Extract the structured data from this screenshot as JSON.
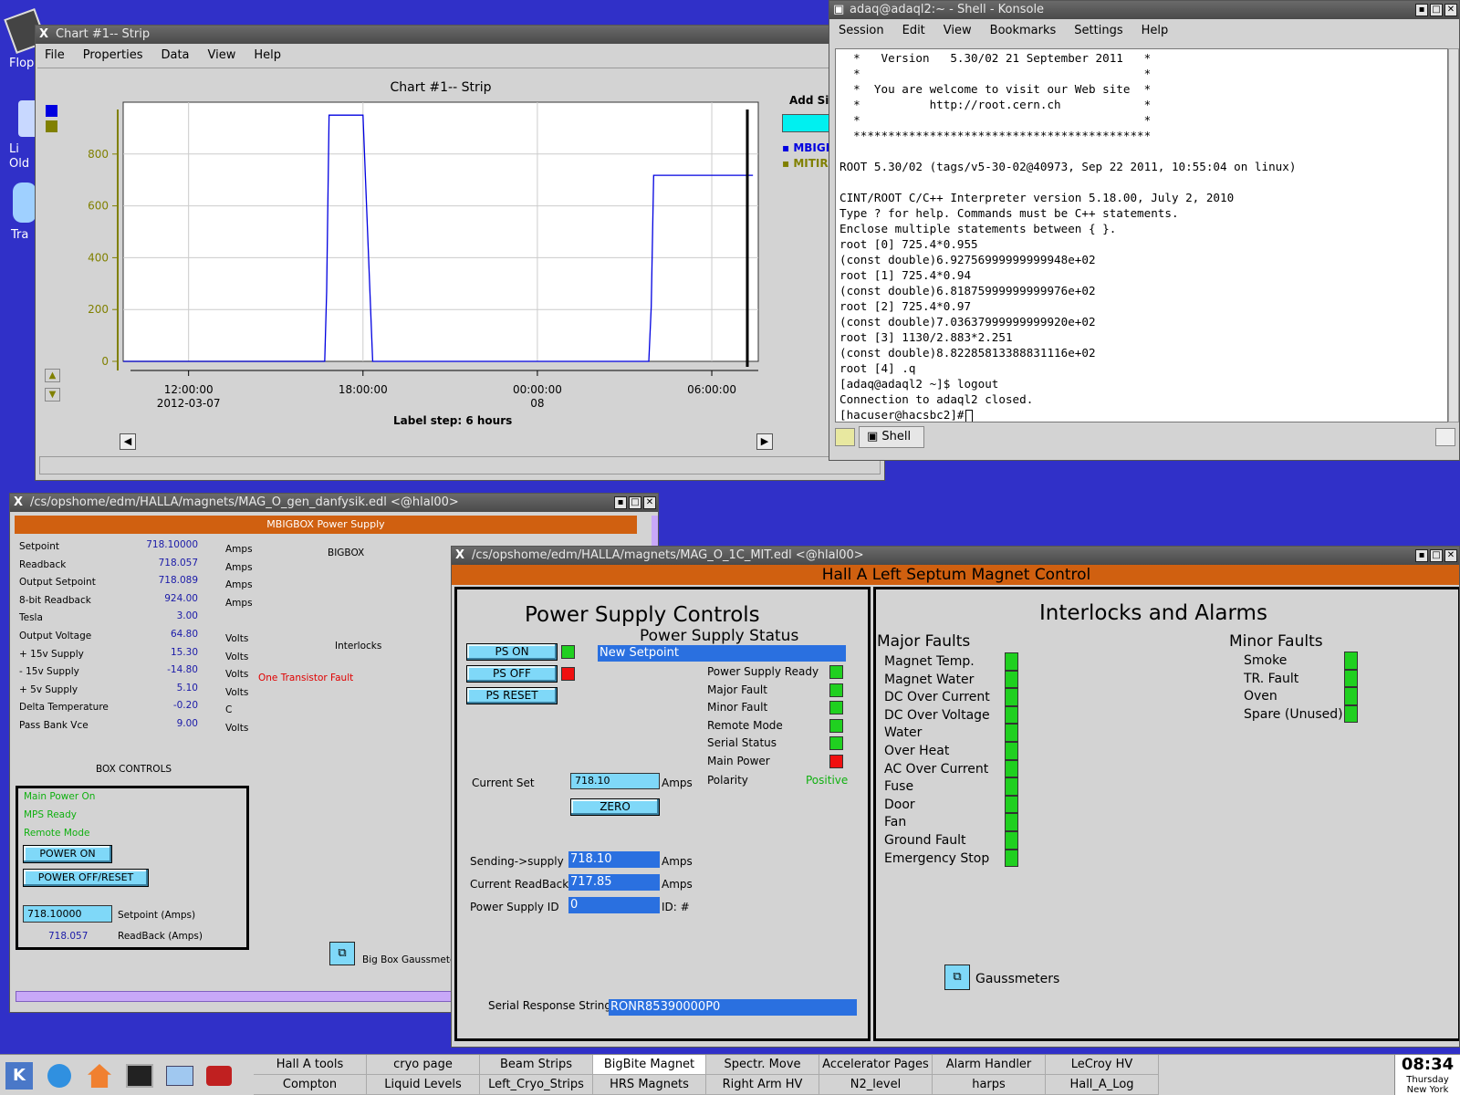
{
  "desktop": {
    "icons": [
      "Flop",
      "Li\nOld",
      "Tra"
    ]
  },
  "chart_window": {
    "title": "Chart #1-- Strip",
    "menu": [
      "File",
      "Properties",
      "Data",
      "View",
      "Help"
    ],
    "add_sig": "Add Sig",
    "legend": [
      "MBIGB",
      "MITIRE"
    ],
    "label_step": "Label step: 6 hours"
  },
  "chart_data": {
    "type": "line",
    "title": "Chart #1-- Strip",
    "xlabel": "",
    "ylabel": "",
    "y_ticks": [
      "0",
      "200",
      "400",
      "600",
      "800"
    ],
    "ylim": [
      0,
      1000
    ],
    "x_ticks": [
      {
        "time": "12:00:00",
        "date": "2012-03-07"
      },
      {
        "time": "18:00:00",
        "date": ""
      },
      {
        "time": "00:00:00",
        "date": "08"
      },
      {
        "time": "06:00:00",
        "date": ""
      }
    ],
    "series": [
      {
        "name": "MBIGB",
        "color": "#0000e0",
        "x": [
          "09:45",
          "16:41",
          "16:45",
          "16:50",
          "18:00",
          "18:20",
          "03:50",
          "03:55",
          "04:00",
          "07:25"
        ],
        "values": [
          0,
          0,
          270,
          950,
          950,
          0,
          0,
          210,
          718,
          718
        ]
      },
      {
        "name": "MITIRE",
        "color": "#808000",
        "x": [
          "09:45",
          "16:41"
        ],
        "values": [
          0,
          0
        ]
      }
    ]
  },
  "konsole": {
    "title": "adaq@adaql2:~ - Shell - Konsole",
    "menu": [
      "Session",
      "Edit",
      "View",
      "Bookmarks",
      "Settings",
      "Help"
    ],
    "tab": "Shell",
    "lines": [
      "  *   Version   5.30/02 21 September 2011   *",
      "  *                                         *",
      "  *  You are welcome to visit our Web site  *",
      "  *          http://root.cern.ch            *",
      "  *                                         *",
      "  *******************************************",
      "",
      "ROOT 5.30/02 (tags/v5-30-02@40973, Sep 22 2011, 10:55:04 on linux)",
      "",
      "CINT/ROOT C/C++ Interpreter version 5.18.00, July 2, 2010",
      "Type ? for help. Commands must be C++ statements.",
      "Enclose multiple statements between { }.",
      "root [0] 725.4*0.955",
      "(const double)6.92756999999999948e+02",
      "root [1] 725.4*0.94",
      "(const double)6.81875999999999976e+02",
      "root [2] 725.4*0.97",
      "(const double)7.03637999999999920e+02",
      "root [3] 1130/2.883*2.251",
      "(const double)8.82285813388831116e+02",
      "root [4] .q",
      "[adaq@adaql2 ~]$ logout",
      "Connection to adaql2 closed.",
      "[hacuser@hacsbc2]#"
    ]
  },
  "bigbox": {
    "title": "/cs/opshome/edm/HALLA/magnets/MAG_O_gen_danfysik.edl <@hlal00>",
    "header": "MBIGBOX Power Supply",
    "bigbox_label": "BIGBOX",
    "interlocks_label": "Interlocks",
    "fault": "One Transistor Fault",
    "rows": [
      {
        "label": "Setpoint",
        "value": "718.10000",
        "unit": "Amps"
      },
      {
        "label": "Readback",
        "value": "718.057",
        "unit": "Amps"
      },
      {
        "label": "Output Setpoint",
        "value": "718.089",
        "unit": "Amps"
      },
      {
        "label": "8-bit Readback",
        "value": "924.00",
        "unit": "Amps"
      },
      {
        "label": "Tesla",
        "value": "3.00",
        "unit": ""
      },
      {
        "label": "Output Voltage",
        "value": "64.80",
        "unit": "Volts"
      },
      {
        "label": "+ 15v Supply",
        "value": "15.30",
        "unit": "Volts"
      },
      {
        "label": "- 15v Supply",
        "value": "-14.80",
        "unit": "Volts"
      },
      {
        "label": "+ 5v Supply",
        "value": "5.10",
        "unit": "Volts"
      },
      {
        "label": "Delta Temperature",
        "value": "-0.20",
        "unit": "C"
      },
      {
        "label": "Pass Bank Vce",
        "value": "9.00",
        "unit": "Volts"
      }
    ],
    "box_controls": "BOX CONTROLS",
    "status": [
      "Main Power On",
      "MPS Ready",
      "Remote Mode"
    ],
    "power_on": "POWER ON",
    "power_off": "POWER OFF/RESET",
    "setpoint_value": "718.10000",
    "setpoint_label": "Setpoint (Amps)",
    "readback_value": "718.057",
    "readback_label": "ReadBack (Amps)",
    "gaussmeter": "Big Box Gaussmeter"
  },
  "septum": {
    "title": "/cs/opshome/edm/HALLA/magnets/MAG_O_1C_MIT.edl <@hlal00>",
    "header": "Hall A Left Septum Magnet Control",
    "ps_controls": "Power Supply Controls",
    "ps_on": "PS ON",
    "ps_off": "PS OFF",
    "ps_reset": "PS RESET",
    "ps_status": "Power Supply Status",
    "status_text": "New Setpoint",
    "status_rows": [
      {
        "label": "Power Supply Ready",
        "color": "#20d020"
      },
      {
        "label": "Major Fault",
        "color": "#20d020"
      },
      {
        "label": "Minor Fault",
        "color": "#20d020"
      },
      {
        "label": "Remote Mode",
        "color": "#20d020"
      },
      {
        "label": "Serial Status",
        "color": "#20d020"
      },
      {
        "label": "Main Power",
        "color": "#f01010"
      }
    ],
    "polarity_label": "Polarity",
    "polarity_value": "Positive",
    "current_set_label": "Current Set",
    "current_set_value": "718.10",
    "amps": "Amps",
    "zero": "ZERO",
    "sending_label": "Sending->supply",
    "sending_value": "718.10",
    "readback_label": "Current ReadBack",
    "readback_value": "717.85",
    "psid_label": "Power Supply ID",
    "psid_value": "0",
    "id_unit": "ID: #",
    "serial_label": "Serial Response String",
    "serial_value": "RONR85390000P0",
    "interlocks": "Interlocks and Alarms",
    "major": "Major Faults",
    "minor": "Minor Faults",
    "major_items": [
      "Magnet Temp.",
      "Magnet Water",
      "DC Over Current",
      "DC Over Voltage",
      "Water",
      "Over Heat",
      "AC Over Current",
      "Fuse",
      "Door",
      "Fan",
      "Ground Fault",
      "Emergency Stop"
    ],
    "minor_items": [
      "Smoke",
      "TR. Fault",
      "Oven",
      "Spare (Unused)"
    ],
    "gaussmeters": "Gaussmeters"
  },
  "taskbar": {
    "row1": [
      "Hall A tools",
      "cryo page",
      "Beam Strips",
      "BigBite Magnet",
      "Spectr. Move",
      "Accelerator Pages",
      "Alarm Handler",
      "LeCroy HV"
    ],
    "row2": [
      "Compton",
      "Liquid Levels",
      "Left_Cryo_Strips",
      "HRS Magnets",
      "Right Arm HV",
      "N2_level",
      "harps",
      "Hall_A_Log"
    ],
    "clock_time": "08:34",
    "clock_day": "Thursday",
    "clock_city": "New York"
  }
}
